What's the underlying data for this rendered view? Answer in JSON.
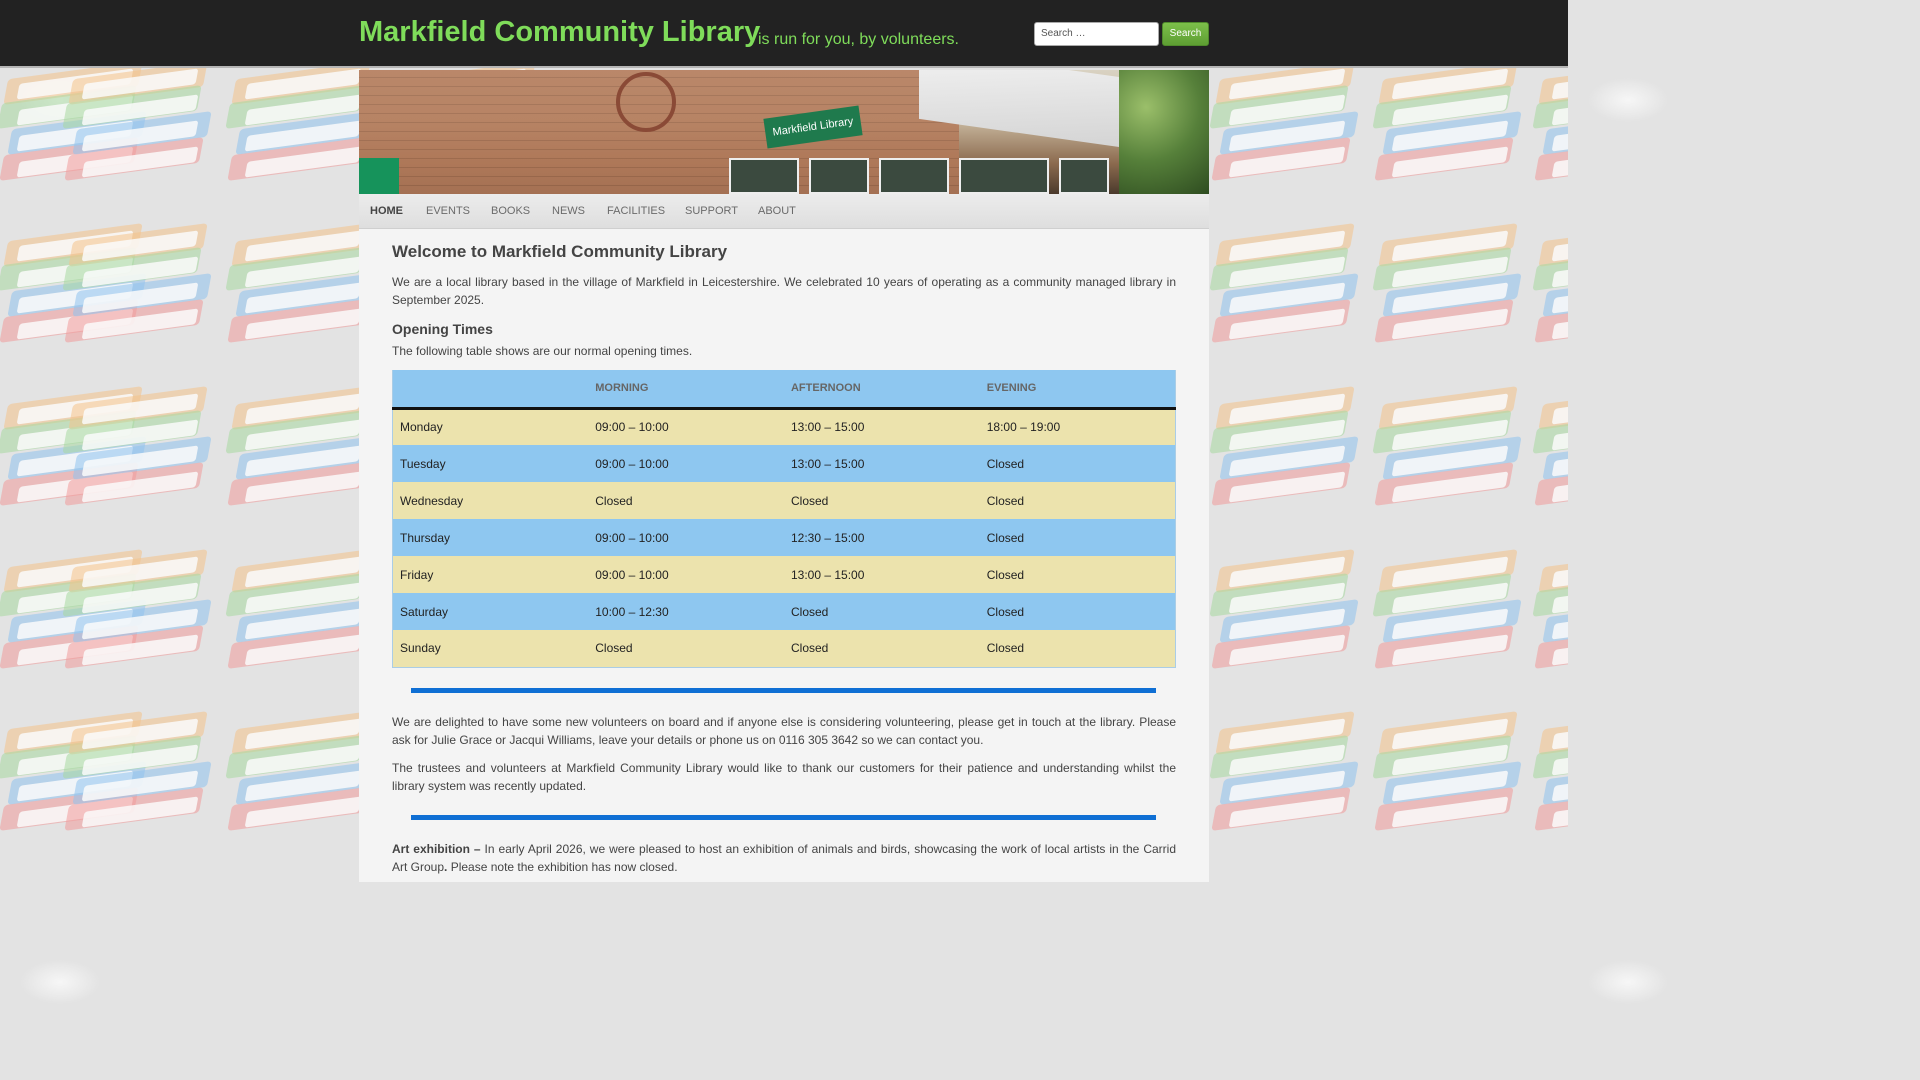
{
  "header": {
    "site_title": "Markfield Community Library",
    "tagline": "is run for you, by volunteers.",
    "search_placeholder": "Search …",
    "search_button": "Search"
  },
  "nav": {
    "items": [
      "HOME",
      "EVENTS",
      "BOOKS",
      "NEWS",
      "FACILITIES",
      "SUPPORT",
      "ABOUT"
    ],
    "active": "HOME"
  },
  "page": {
    "title": "Welcome to Markfield Community Library",
    "intro": "We are a local library based in the village of Markfield in Leicestershire. We celebrated 10 years of operating as a community managed library in September 2025.",
    "opening_title": "Opening Times",
    "opening_intro": "The following table shows are our normal opening times.",
    "volunteers": "We are delighted to have some new volunteers on board and if anyone else is considering volunteering, please get in touch at the library. Please ask for Julie Grace or Jacqui Williams, leave your details or phone us on 0116 305 3642 so we can contact you.",
    "thanks": "The trustees and volunteers at Markfield Community Library would like to thank our customers for their patience and understanding whilst the library system was recently updated.",
    "art_label": "Art exhibition –",
    "art_text": " In early April 2026, we were pleased to host an exhibition of animals and birds, showcasing the work of local artists in the Carrid Art Group",
    "art_period": ".",
    "art_closed": " Please note the exhibition has now closed."
  },
  "hours": {
    "headers": [
      "",
      "MORNING",
      "AFTERNOON",
      "EVENING"
    ],
    "rows": [
      [
        "Monday",
        "09:00 – 10:00",
        "13:00 – 15:00",
        "18:00 – 19:00"
      ],
      [
        "Tuesday",
        "09:00 – 10:00",
        "13:00 – 15:00",
        "Closed"
      ],
      [
        "Wednesday",
        "Closed",
        "Closed",
        "Closed"
      ],
      [
        "Thursday",
        "09:00 – 10:00",
        "12:30 – 15:00",
        "Closed"
      ],
      [
        "Friday",
        "09:00 – 10:00",
        "13:00 – 15:00",
        "Closed"
      ],
      [
        "Saturday",
        "10:00 – 12:30",
        "Closed",
        "Closed"
      ],
      [
        "Sunday",
        "Closed",
        "Closed",
        "Closed"
      ]
    ]
  },
  "banner": {
    "sign_text": "Markfield Library"
  },
  "colors": {
    "title_green": "#7fdc5a",
    "header_dark": "#222222",
    "table_blue": "#8ec7f0",
    "table_yellow": "#ece3ad",
    "divider_blue": "#0f6fd4"
  }
}
